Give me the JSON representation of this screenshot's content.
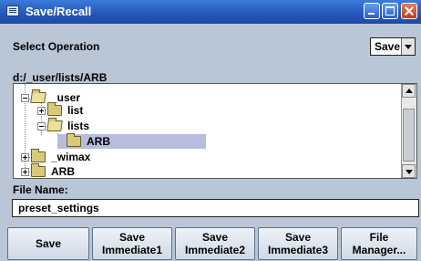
{
  "window": {
    "title": "Save/Recall"
  },
  "select_operation": {
    "label": "Select Operation",
    "value": "Save"
  },
  "path": "d:/_user/lists/ARB",
  "tree": {
    "nodes": [
      {
        "label": "_user",
        "open": true
      },
      {
        "label": "list",
        "open": false
      },
      {
        "label": "lists",
        "open": true
      },
      {
        "label": "ARB",
        "open": false,
        "selected": true
      },
      {
        "label": "_wimax",
        "open": false
      },
      {
        "label": "ARB",
        "open": false
      }
    ]
  },
  "file_name": {
    "label": "File Name:",
    "value": "preset_settings"
  },
  "buttons": [
    {
      "label": "Save"
    },
    {
      "label": "Save\nImmediate1"
    },
    {
      "label": "Save\nImmediate2"
    },
    {
      "label": "Save\nImmediate3"
    },
    {
      "label": "File\nManager..."
    }
  ]
}
